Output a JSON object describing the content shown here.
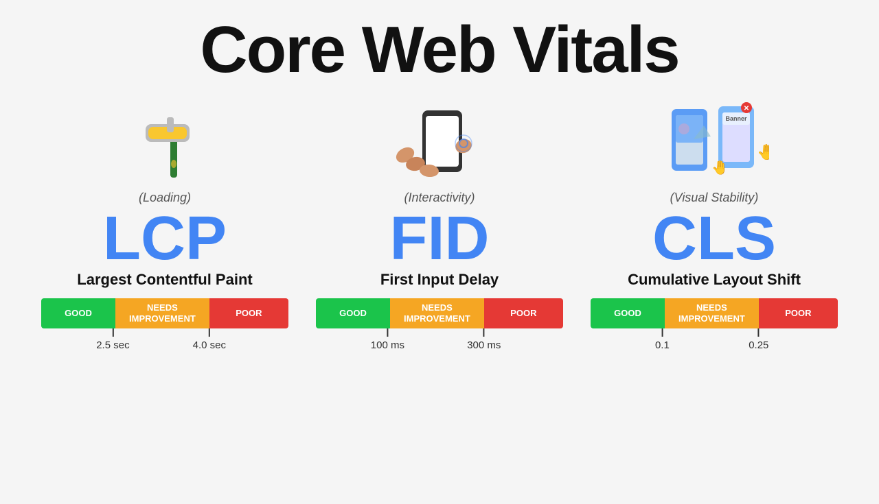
{
  "page": {
    "title": "Core Web Vitals"
  },
  "vitals": [
    {
      "id": "lcp",
      "icon": "paint-roller",
      "category": "(Loading)",
      "acronym": "LCP",
      "name": "Largest Contentful Paint",
      "bar": {
        "good_label": "GOOD",
        "needs_label": "NEEDS\nIMPROVEMENT",
        "poor_label": "POOR"
      },
      "tick1_value": "2.5 sec",
      "tick2_value": "4.0 sec"
    },
    {
      "id": "fid",
      "icon": "tap-finger",
      "category": "(Interactivity)",
      "acronym": "FID",
      "name": "First Input Delay",
      "bar": {
        "good_label": "GOOD",
        "needs_label": "NEEDS\nIMPROVEMENT",
        "poor_label": "POOR"
      },
      "tick1_value": "100 ms",
      "tick2_value": "300 ms"
    },
    {
      "id": "cls",
      "icon": "layout-shift",
      "category": "(Visual Stability)",
      "acronym": "CLS",
      "name": "Cumulative Layout Shift",
      "bar": {
        "good_label": "GOOD",
        "needs_label": "NEEDS\nIMPROVEMENT",
        "poor_label": "POOR"
      },
      "tick1_value": "0.1",
      "tick2_value": "0.25"
    }
  ],
  "colors": {
    "good": "#1bc44b",
    "needs": "#f5a623",
    "poor": "#e53935",
    "accent": "#4285f4"
  }
}
